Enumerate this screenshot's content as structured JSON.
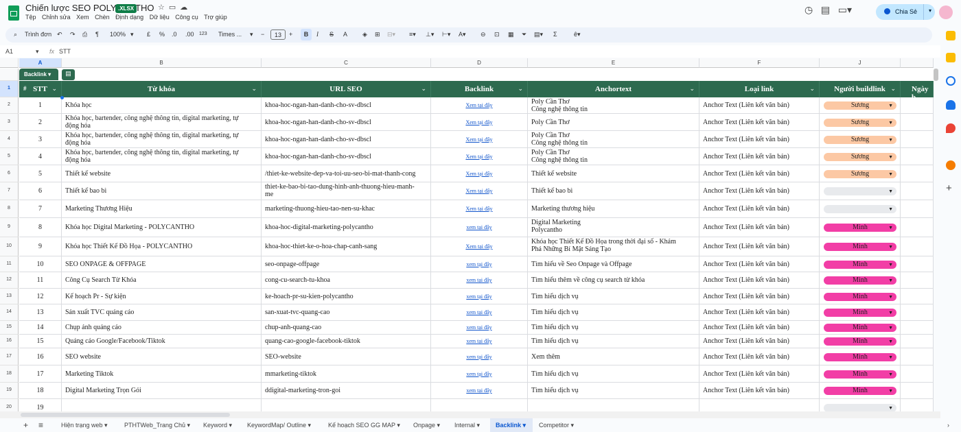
{
  "app": {
    "title": "Chiến lược SEO POLYCANTHO",
    "badge": ".XLSX",
    "share": "Chia Sẻ"
  },
  "menu": [
    "Tệp",
    "Chỉnh sửa",
    "Xem",
    "Chèn",
    "Định dạng",
    "Dữ liệu",
    "Công cụ",
    "Trợ giúp"
  ],
  "toolbar": {
    "search": "Trình đơn",
    "zoom": "100%",
    "currency": "£",
    "percent": "%",
    "dec_less": ".0",
    "dec_more": ".00",
    "num": "123",
    "font": "Times ...",
    "font_size": "13",
    "bold": "B",
    "italic": "I",
    "strike": "S",
    "textcolor": "A",
    "sigma": "Σ"
  },
  "formula": {
    "ref": "A1",
    "fx": "fx",
    "value": "STT"
  },
  "columns": [
    "A",
    "B",
    "C",
    "D",
    "E",
    "F",
    "J"
  ],
  "table": {
    "name": "Backlink"
  },
  "headers": {
    "stt": "STT",
    "hash": "#",
    "keyword": "Từ khóa",
    "url": "URL SEO",
    "backlink": "Backlink",
    "anchor": "Anchortext",
    "linktype": "Loại link",
    "builder": "Người buildlink",
    "date": "Ngày b"
  },
  "rownums": [
    "1",
    "2",
    "3",
    "4",
    "5",
    "6",
    "7",
    "8",
    "9",
    "10",
    "11",
    "12",
    "13",
    "14",
    "15",
    "16",
    "17",
    "18",
    "19",
    "20"
  ],
  "rows": [
    {
      "stt": "1",
      "keyword": "Khóa học",
      "url": "khoa-hoc-ngan-han-danh-cho-sv-dbscl",
      "link": "Xem tại đây",
      "anchor": "Poly Cần Thơ",
      "anchor2": "Công nghệ thông tin",
      "type": "Anchor Text (Liên kết văn bản)",
      "builder": "Sương"
    },
    {
      "stt": "2",
      "keyword": "Khóa học, bartender, công nghệ thông tin, digital marketing, tự",
      "keyword2": "động hóa",
      "url": "khoa-hoc-ngan-han-danh-cho-sv-dbscl",
      "link": "Xem tại đây",
      "anchor": "Poly Cần Thơ",
      "type": "Anchor Text (Liên kết văn bản)",
      "builder": "Sương"
    },
    {
      "stt": "3",
      "keyword": "Khóa học, bartender, công nghệ thông tin, digital marketing, tự",
      "keyword2": "động hóa",
      "url": "khoa-hoc-ngan-han-danh-cho-sv-dbscl",
      "link": "Xem tại đây",
      "anchor": "Poly Cần Thơ",
      "anchor2": "Công nghệ thông tin",
      "type": "Anchor Text (Liên kết văn bản)",
      "builder": "Sương"
    },
    {
      "stt": "4",
      "keyword": "Khóa học, bartender, công nghệ thông tin, digital marketing, tự",
      "keyword2": "động hóa",
      "url": "khoa-hoc-ngan-han-danh-cho-sv-dbscl",
      "link": "Xem tại đây",
      "anchor": "Poly Cần Thơ",
      "anchor2": "Công nghệ thông tin",
      "type": "Anchor Text (Liên kết văn bản)",
      "builder": "Sương"
    },
    {
      "stt": "5",
      "keyword": "Thiết kế website",
      "url": "/thiet-ke-website-dep-va-toi-uu-seo-bi-mat-thanh-cong",
      "link": "Xem tại đây",
      "anchor": "Thiết kế website",
      "type": "Anchor Text (Liên kết văn bản)",
      "builder": "Sương"
    },
    {
      "stt": "6",
      "keyword": "Thiết kế bao bì",
      "url": "thiet-ke-bao-bi-tao-dung-hinh-anh-thuong-hieu-manh-",
      "url2": "me",
      "link": "Xem tại đây",
      "anchor": "Thiết kế bao bì",
      "type": "Anchor Text (Liên kết văn bản)",
      "builder": ""
    },
    {
      "stt": "7",
      "keyword": "Marketing Thương Hiệu",
      "url": "marketing-thuong-hieu-tao-nen-su-khac",
      "link": "Xem tại đây",
      "anchor": "Marketing thương hiệu",
      "type": "Anchor Text (Liên kết văn bản)",
      "builder": ""
    },
    {
      "stt": "8",
      "keyword": "Khóa học Digital Marketing - POLYCANTHO",
      "url": "khoa-hoc-digital-marketing-polycantho",
      "link": "xem tại đây",
      "anchor": "Digital Marketing",
      "anchor2": "Polycantho",
      "type": "Anchor Text (Liên kết văn bản)",
      "builder": "Minh"
    },
    {
      "stt": "9",
      "keyword": "Khóa học Thiết Kế Đồ Họa - POLYCANTHO",
      "url": "khoa-hoc-thiet-ke-o-hoa-chap-canh-sang",
      "link": "Xem tại đây",
      "anchor": "Khóa học Thiết Kế Đồ Họa trong thời đại số - Khám",
      "anchor2": "Phá Những Bí Mật Sáng Tạo",
      "type": "Anchor Text (Liên kết văn bản)",
      "builder": "Minh"
    },
    {
      "stt": "10",
      "keyword": "SEO ONPAGE & OFFPAGE",
      "url": "seo-onpage-offpage",
      "link": "xem tại đây",
      "anchor": "Tìm hiểu về Seo Onpage và Offpage",
      "type": "Anchor Text (Liên kết văn bản)",
      "builder": "Minh"
    },
    {
      "stt": "11",
      "keyword": "Công Cụ Search Từ Khóa",
      "url": "cong-cu-search-tu-khoa",
      "link": "xem tại đây",
      "anchor": "Tìm hiểu thêm về công cụ search từ khóa",
      "type": "Anchor Text (Liên kết văn bản)",
      "builder": "Minh"
    },
    {
      "stt": "12",
      "keyword": "Kế hoạch Pr -  Sự kiện",
      "url": "ke-hoach-pr-su-kien-polycantho",
      "link": "xem tại đây",
      "anchor": "Tìm hiểu dịch vụ",
      "type": "Anchor Text (Liên kết văn bản)",
      "builder": "Minh"
    },
    {
      "stt": "13",
      "keyword": "Sản xuất TVC quảng cáo",
      "url": "san-xuat-tvc-quang-cao",
      "link": "xem tại đây",
      "anchor": "Tìm hiểu dịch vụ",
      "type": "Anchor Text (Liên kết văn bản)",
      "builder": "Minh"
    },
    {
      "stt": "14",
      "keyword": "Chụp ảnh quảng cáo",
      "url": "chup-anh-quang-cao",
      "link": "xem tại đây",
      "anchor": "Tìm hiểu dịch vụ",
      "type": "Anchor Text (Liên kết văn bản)",
      "builder": "Minh"
    },
    {
      "stt": "15",
      "keyword": "Quảng cáo Google/Facebook/Tiktok",
      "url": "quang-cao-google-facebook-tiktok",
      "link": "xem tại đây",
      "anchor": "Tìm hiểu dịch vụ",
      "type": "Anchor Text (Liên kết văn bản)",
      "builder": "Minh"
    },
    {
      "stt": "16",
      "keyword": "SEO website",
      "url": "SEO-website",
      "link": "xem tại đây",
      "anchor": "Xem thêm",
      "type": "Anchor Text (Liên kết văn bản)",
      "builder": "Minh"
    },
    {
      "stt": "17",
      "keyword": "Marketing Tiktok",
      "url": "mmarketing-tiktok",
      "link": "xem tại đây",
      "anchor": "Tìm hiểu dịch vụ",
      "type": "Anchor Text (Liên kết văn bản)",
      "builder": "Minh"
    },
    {
      "stt": "18",
      "keyword": "Digital Marketing Trọn Gói",
      "url": "ddigital-marketing-tron-goi",
      "link": "xem tại đây",
      "anchor": "Tìm hiểu dịch vụ",
      "type": "Anchor Text (Liên kết văn bản)",
      "builder": "Minh"
    },
    {
      "stt": "19",
      "keyword": "",
      "url": "",
      "link": "",
      "anchor": "",
      "type": "",
      "builder": ""
    }
  ],
  "colors": {
    "header": "#2d6a4f",
    "suong": "#fcc8a4",
    "minh": "#f23ea6",
    "empty": "#e8eaed",
    "link": "#1155cc"
  },
  "tabs": [
    "Hiện trạng web",
    "PTHTWeb_Trang Chủ",
    "Keyword",
    "KeywordMap/ Outline",
    "Kế hoạch SEO GG MAP",
    "Onpage",
    "Internal",
    "Backlink",
    "Competitor"
  ],
  "active_tab": "Backlink"
}
